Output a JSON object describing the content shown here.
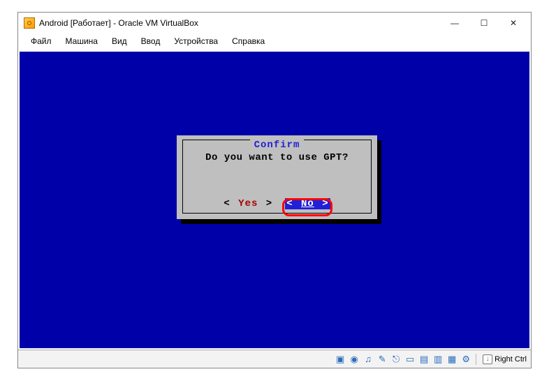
{
  "window": {
    "title": "Android [Работает] - Oracle VM VirtualBox",
    "min": "—",
    "max": "☐",
    "close": "✕"
  },
  "menu": {
    "file": "Файл",
    "machine": "Машина",
    "view": "Вид",
    "input": "Ввод",
    "devices": "Устройства",
    "help": "Справка"
  },
  "dialog": {
    "title": "Confirm",
    "message": "Do you want to use GPT?",
    "yes_l": "<",
    "yes": "Yes",
    "yes_r": ">",
    "no_l": "<",
    "no": "No",
    "no_r": ">"
  },
  "status": {
    "hostkey": "Right Ctrl"
  }
}
